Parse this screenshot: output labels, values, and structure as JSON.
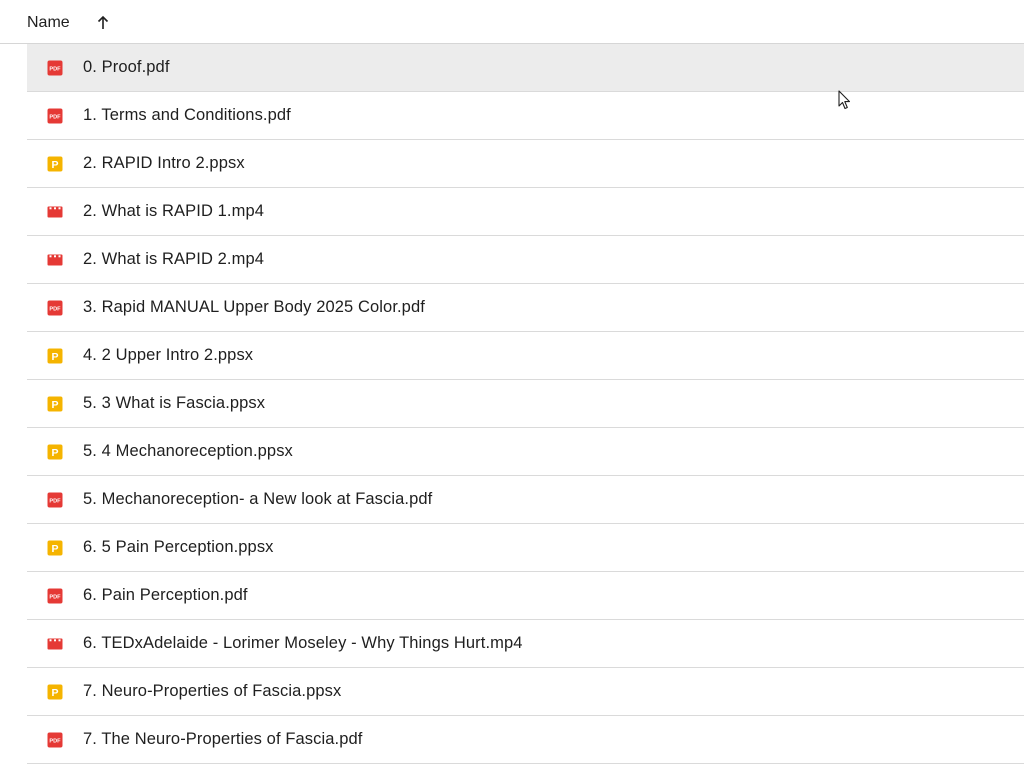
{
  "header": {
    "sort_label": "Name",
    "sort_direction": "ascending"
  },
  "colors": {
    "pdf": "#e53935",
    "ppsx": "#f5b400",
    "video": "#e53935",
    "selected_row": "#ececec"
  },
  "files": [
    {
      "name": "0. Proof.pdf",
      "type": "pdf",
      "icon": "pdf-icon",
      "selected": true
    },
    {
      "name": "1. Terms and Conditions.pdf",
      "type": "pdf",
      "icon": "pdf-icon"
    },
    {
      "name": "2. RAPID Intro 2.ppsx",
      "type": "ppsx",
      "icon": "slides-icon"
    },
    {
      "name": "2. What is RAPID 1.mp4",
      "type": "video",
      "icon": "video-icon"
    },
    {
      "name": "2. What is RAPID 2.mp4",
      "type": "video",
      "icon": "video-icon"
    },
    {
      "name": "3. Rapid MANUAL Upper Body 2025 Color.pdf",
      "type": "pdf",
      "icon": "pdf-icon"
    },
    {
      "name": "4. 2 Upper Intro 2.ppsx",
      "type": "ppsx",
      "icon": "slides-icon"
    },
    {
      "name": "5. 3 What is Fascia.ppsx",
      "type": "ppsx",
      "icon": "slides-icon"
    },
    {
      "name": "5. 4 Mechanoreception.ppsx",
      "type": "ppsx",
      "icon": "slides-icon"
    },
    {
      "name": "5. Mechanoreception- a New look at Fascia.pdf",
      "type": "pdf",
      "icon": "pdf-icon"
    },
    {
      "name": "6. 5 Pain Perception.ppsx",
      "type": "ppsx",
      "icon": "slides-icon"
    },
    {
      "name": "6. Pain Perception.pdf",
      "type": "pdf",
      "icon": "pdf-icon"
    },
    {
      "name": "6. TEDxAdelaide - Lorimer Moseley - Why Things Hurt.mp4",
      "type": "video",
      "icon": "video-icon"
    },
    {
      "name": "7. Neuro-Properties of Fascia.ppsx",
      "type": "ppsx",
      "icon": "slides-icon"
    },
    {
      "name": "7. The Neuro-Properties of Fascia.pdf",
      "type": "pdf",
      "icon": "pdf-icon"
    }
  ]
}
